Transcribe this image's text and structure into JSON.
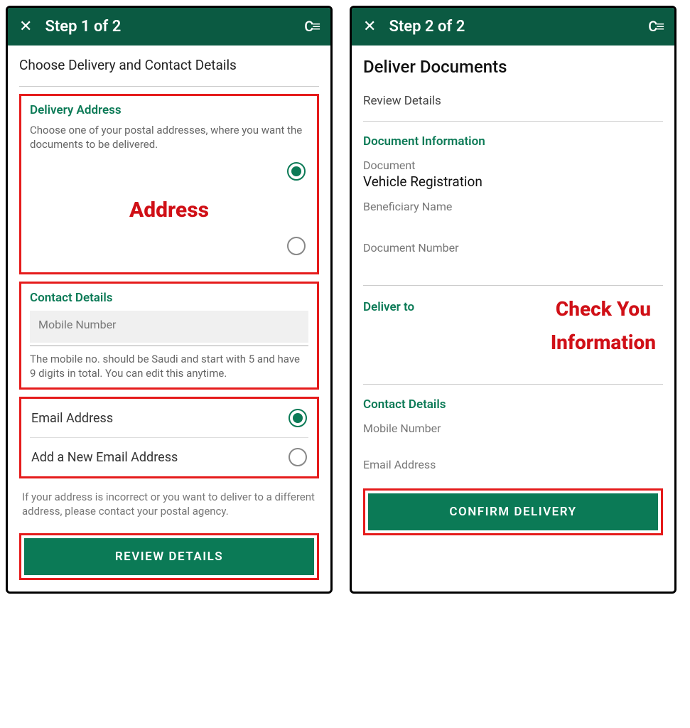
{
  "left": {
    "appbar": {
      "title": "Step 1 of 2"
    },
    "subtitle": "Choose Delivery and Contact Details",
    "delivery": {
      "title": "Delivery Address",
      "desc": "Choose one of your postal addresses, where you want the documents to be delivered.",
      "annotation": "Address"
    },
    "contact": {
      "title": "Contact Details",
      "mobile_label": "Mobile Number",
      "hint": "The mobile no. should be Saudi and start with 5 and have 9 digits in total. You can edit this anytime."
    },
    "email": {
      "existing_label": "Email Address",
      "add_new_label": "Add a New Email Address"
    },
    "footer_note": "If your address is incorrect or you want to deliver to a different address, please contact your postal agency.",
    "button": "REVIEW DETAILS"
  },
  "right": {
    "appbar": {
      "title": "Step 2 of 2"
    },
    "heading": "Deliver Documents",
    "sub": "Review Details",
    "docinfo": {
      "title": "Document Information",
      "doc_label": "Document",
      "doc_value": "Vehicle Registration",
      "ben_label": "Beneficiary Name",
      "num_label": "Document Number"
    },
    "deliver_to": {
      "title": "Deliver to",
      "annotation_l1": "Check You",
      "annotation_l2": "Information"
    },
    "contact": {
      "title": "Contact Details",
      "mobile_label": "Mobile Number",
      "email_label": "Email Address"
    },
    "button": "CONFIRM DELIVERY"
  }
}
